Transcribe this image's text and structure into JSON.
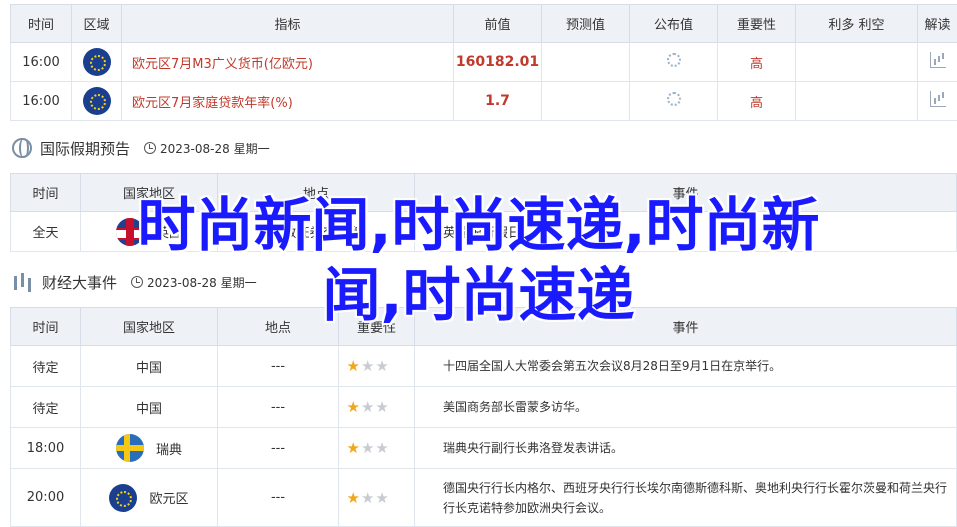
{
  "table1": {
    "headers": [
      "时间",
      "区域",
      "指标",
      "前值",
      "预测值",
      "公布值",
      "重要性",
      "利多 利空",
      "解读"
    ],
    "rows": [
      {
        "time": "16:00",
        "indicator": "欧元区7月M3广义货币(亿欧元)",
        "previous": "160182.01",
        "importance": "高"
      },
      {
        "time": "16:00",
        "indicator": "欧元区7月家庭贷款年率(%)",
        "previous": "1.7",
        "importance": "高"
      }
    ]
  },
  "holiday_section": {
    "title": "国际假期预告",
    "date": "2023-08-28 星期一"
  },
  "table2": {
    "headers": [
      "时间",
      "国家地区",
      "地点",
      "事件"
    ],
    "rows": [
      {
        "time": "全天",
        "country": "英国",
        "place": "伦敦证券交易所",
        "event": "英国银行假日"
      }
    ]
  },
  "events_section": {
    "title": "财经大事件",
    "date": "2023-08-28 星期一"
  },
  "table3": {
    "headers": [
      "时间",
      "国家地区",
      "地点",
      "重要性",
      "事件"
    ],
    "rows": [
      {
        "time": "待定",
        "country": "中国",
        "place": "---",
        "stars": 1,
        "event": "十四届全国人大常委会第五次会议8月28日至9月1日在京举行。"
      },
      {
        "time": "待定",
        "country": "中国",
        "place": "---",
        "stars": 1,
        "event": "美国商务部长雷蒙多访华。"
      },
      {
        "time": "18:00",
        "country": "瑞典",
        "place": "---",
        "stars": 1,
        "event": "瑞典央行副行长弗洛登发表讲话。"
      },
      {
        "time": "20:00",
        "country": "欧元区",
        "place": "---",
        "stars": 1,
        "event": "德国央行行长内格尔、西班牙央行行长埃尔南德斯德科斯、奥地利央行行长霍尔茨曼和荷兰央行行长克诺特参加欧洲央行会议。"
      }
    ]
  },
  "overlay": {
    "line1": "时尚新闻,时尚速递,时尚新",
    "line2": "闻,时尚速递"
  },
  "colors": {
    "accent_red": "#c0392b",
    "overlay_blue": "#1a1aff",
    "header_bg": "#eef2f6",
    "star": "#f0a71b"
  }
}
